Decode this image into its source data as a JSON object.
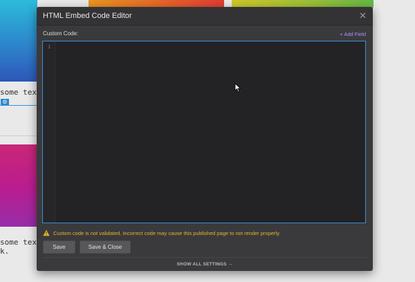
{
  "background": {
    "text_line_1": "some text",
    "text_line_2": "some text",
    "text_line_3": "k."
  },
  "modal": {
    "title": "HTML Embed Code Editor",
    "close_icon": "close-icon",
    "field_label": "Custom Code:",
    "add_field_label": "+ Add Field",
    "editor": {
      "line_numbers": [
        "1"
      ],
      "content": ""
    },
    "warning": {
      "icon": "warning-icon",
      "text": "Custom code is not validated. Incorrect code may cause this published page to not render properly."
    },
    "buttons": {
      "save": "Save",
      "save_close": "Save & Close"
    },
    "show_all_settings": "SHOW ALL SETTINGS →"
  },
  "colors": {
    "modal_bg": "#3a3a3d",
    "editor_bg": "#232326",
    "editor_border": "#3b8fd0",
    "accent_link": "#a995ef",
    "warning": "#e5b52c"
  }
}
